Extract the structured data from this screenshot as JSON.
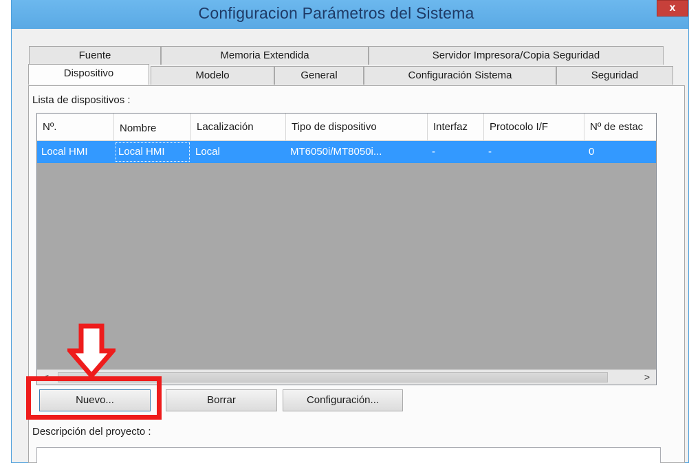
{
  "window": {
    "title": "Configuracion Parámetros del Sistema",
    "close_glyph": "x"
  },
  "tabs_row1": [
    {
      "label": "Fuente"
    },
    {
      "label": "Memoria Extendida"
    },
    {
      "label": "Servidor Impresora/Copia Seguridad"
    }
  ],
  "tabs_row2": [
    {
      "label": "Dispositivo",
      "active": true
    },
    {
      "label": "Modelo"
    },
    {
      "label": "General"
    },
    {
      "label": "Configuración Sistema"
    },
    {
      "label": "Seguridad"
    }
  ],
  "device_list": {
    "label": "Lista de dispositivos :",
    "columns": [
      "Nº.",
      "Nombre",
      "Lacalización",
      "Tipo de dispositivo",
      "Interfaz",
      "Protocolo I/F",
      "Nº de estac"
    ],
    "rows": [
      [
        "Local HMI",
        "Local HMI",
        "Local",
        "MT6050i/MT8050i...",
        "-",
        "-",
        "0"
      ]
    ],
    "scroll_left": "<",
    "scroll_right": ">"
  },
  "buttons": {
    "new": "Nuevo...",
    "delete": "Borrar",
    "config": "Configuración..."
  },
  "project": {
    "label": "Descripción del proyecto :"
  },
  "annotation": {
    "color": "#ee1c1c",
    "icon": "down-arrow-icon"
  },
  "colors": {
    "selection": "#3399ff",
    "titlebar": "#5aa9e4",
    "close": "#c7403a"
  }
}
